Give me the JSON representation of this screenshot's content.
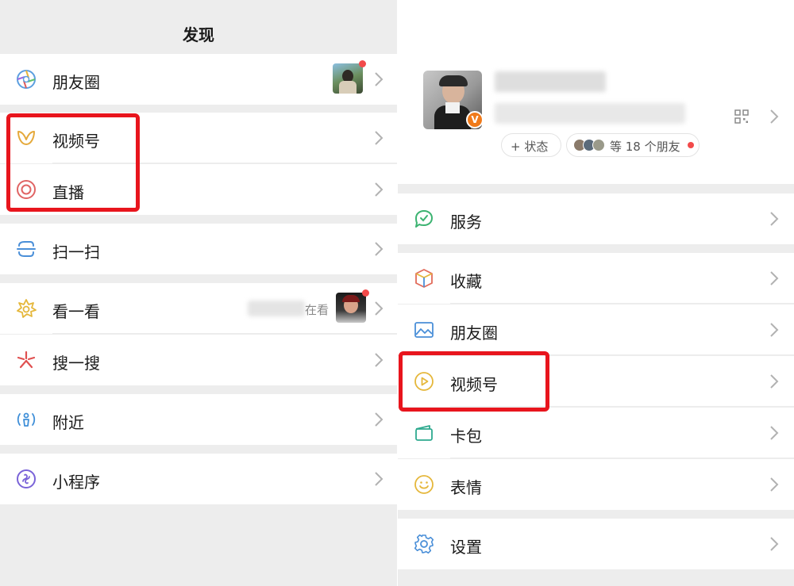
{
  "left": {
    "title": "发现",
    "items": [
      {
        "label": "朋友圈",
        "icon": "moments-aperture-icon"
      },
      {
        "label": "视频号",
        "icon": "channels-butterfly-icon"
      },
      {
        "label": "直播",
        "icon": "live-ring-icon"
      },
      {
        "label": "扫一扫",
        "icon": "scan-icon"
      },
      {
        "label": "看一看",
        "icon": "top-stories-icon",
        "extra": "在看"
      },
      {
        "label": "搜一搜",
        "icon": "search-sparkle-icon"
      },
      {
        "label": "附近",
        "icon": "nearby-person-icon"
      },
      {
        "label": "小程序",
        "icon": "mini-program-icon"
      }
    ]
  },
  "right": {
    "profile": {
      "status_button": "+ 状态",
      "friends_text": "等 18 个朋友"
    },
    "items": [
      {
        "label": "服务",
        "icon": "services-icon"
      },
      {
        "label": "收藏",
        "icon": "favorites-cube-icon"
      },
      {
        "label": "朋友圈",
        "icon": "moments-image-icon"
      },
      {
        "label": "视频号",
        "icon": "channels-play-icon"
      },
      {
        "label": "卡包",
        "icon": "card-wallet-icon"
      },
      {
        "label": "表情",
        "icon": "sticker-smile-icon"
      },
      {
        "label": "设置",
        "icon": "settings-gear-icon"
      }
    ]
  },
  "colors": {
    "background": "#ededed",
    "row": "#ffffff",
    "highlight": "#e8151d",
    "badge": "#f24a4a",
    "chevron": "#b2b2b2"
  }
}
